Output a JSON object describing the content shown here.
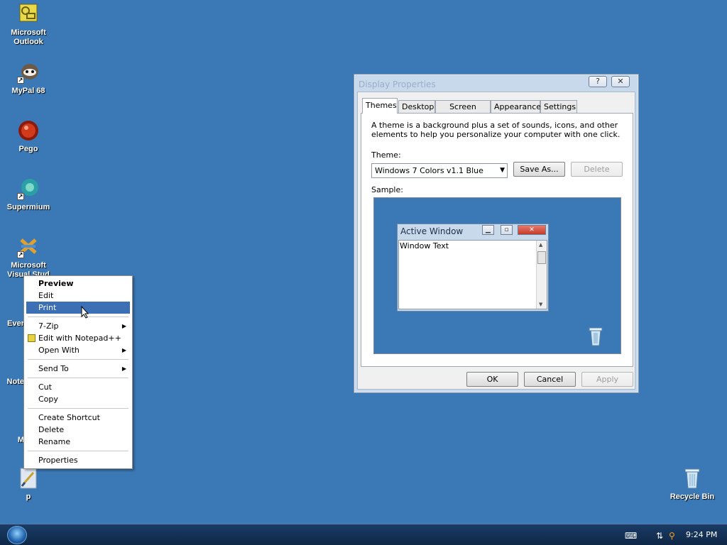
{
  "desktop_icons": [
    {
      "id": "outlook",
      "label_lines": [
        "Microsoft",
        "Outlook"
      ],
      "icon": "outlook-icon"
    },
    {
      "id": "mypal",
      "label_lines": [
        "MyPal 68"
      ],
      "icon": "mypal-icon"
    },
    {
      "id": "pego",
      "label_lines": [
        "Pego"
      ],
      "icon": "pego-icon"
    },
    {
      "id": "supermium",
      "label_lines": [
        "Supermium"
      ],
      "icon": "supermium-icon"
    },
    {
      "id": "visualstudio",
      "label_lines": [
        "Microsoft",
        "Visual Stud"
      ],
      "icon": "visual-studio-icon"
    },
    {
      "id": "ever",
      "label_lines": [
        "Ever"
      ],
      "icon": "evernote-icon"
    },
    {
      "id": "note",
      "label_lines": [
        "Note"
      ],
      "icon": "notepad-icon"
    },
    {
      "id": "m",
      "label_lines": [
        "M"
      ],
      "icon": "app-icon"
    },
    {
      "id": "p",
      "label_lines": [
        "p"
      ],
      "icon": "file-icon"
    },
    {
      "id": "recycle",
      "label_lines": [
        "Recycle Bin"
      ],
      "icon": "recycle-bin-icon"
    }
  ],
  "context_menu": {
    "items": [
      "Preview",
      "Edit",
      "Print",
      "7-Zip",
      "Edit with Notepad++",
      "Open With",
      "Send To",
      "Cut",
      "Copy",
      "Create Shortcut",
      "Delete",
      "Rename",
      "Properties"
    ]
  },
  "dialog": {
    "title": "Display Properties",
    "help_glyph": "?",
    "close_glyph": "✕",
    "tabs": [
      "Themes",
      "Desktop",
      "Screen Saver",
      "Appearance",
      "Settings"
    ],
    "description": "A theme is a background plus a set of sounds, icons, and other elements to help you personalize your computer with one click.",
    "theme_label": "Theme:",
    "theme_value": "Windows 7 Colors v1.1 Blue",
    "save_as": "Save As...",
    "delete": "Delete",
    "sample_label": "Sample:",
    "sample": {
      "window_title": "Active Window",
      "window_text": "Window Text"
    },
    "ok": "OK",
    "cancel": "Cancel",
    "apply": "Apply"
  },
  "taskbar": {
    "clock": "9:24 PM"
  }
}
